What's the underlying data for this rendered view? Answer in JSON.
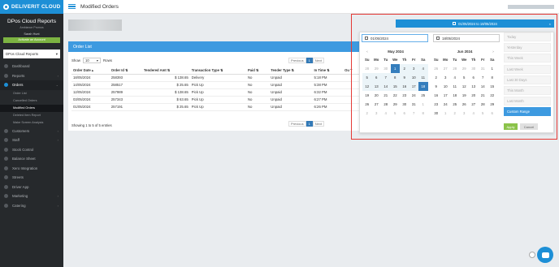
{
  "app": {
    "brand": "DELIVERIT CLOUD",
    "page_title": "Modified Orders"
  },
  "sidebar": {
    "title": "DPos Cloud Reports",
    "subtitle": "Ambiance Promos",
    "user": "Sarah Hunt",
    "activate_label": "Activate an Account",
    "store_select": "DPos Cloud Reports",
    "items": [
      {
        "label": "Dashboard"
      },
      {
        "label": "Reports"
      },
      {
        "label": "Orders"
      },
      {
        "label": "Customers"
      },
      {
        "label": "Staff"
      },
      {
        "label": "Stock Control"
      },
      {
        "label": "Balance Sheet"
      },
      {
        "label": "Xero Integration"
      },
      {
        "label": "Streets"
      },
      {
        "label": "Driver App"
      },
      {
        "label": "Marketing"
      },
      {
        "label": "Catering"
      }
    ],
    "orders_sub": [
      {
        "label": "Order List"
      },
      {
        "label": "Cancelled Orders"
      },
      {
        "label": "Modified Orders"
      },
      {
        "label": "Deleted Item Report"
      },
      {
        "label": "Make Screen Analysis"
      }
    ]
  },
  "order_list": {
    "title": "Order List",
    "show_label": "Show",
    "rows_value": "10",
    "rows_label": "Rows",
    "pager": {
      "prev": "Previous",
      "page": "1",
      "next": "Next"
    },
    "columns": [
      "Order Date",
      "Order Id",
      "Tendered Amt",
      "Transaction Type",
      "Paid",
      "Tender Type",
      "In Time",
      "Ou T"
    ],
    "rows": [
      [
        "18/05/2024",
        "258393",
        "$ 138.65",
        "Delivery",
        "No",
        "Unpaid",
        "5:18 PM"
      ],
      [
        "14/05/2024",
        "258517",
        "$ 25.65",
        "Pick Up",
        "No",
        "Unpaid",
        "5:38 PM"
      ],
      [
        "12/05/2024",
        "257989",
        "$ 138.65",
        "Pick Up",
        "No",
        "Unpaid",
        "6:32 PM"
      ],
      [
        "03/05/2024",
        "257343",
        "$ 63.65",
        "Pick Up",
        "No",
        "Unpaid",
        "6:27 PM"
      ],
      [
        "01/05/2024",
        "257191",
        "$ 25.65",
        "Pick Up",
        "No",
        "Unpaid",
        "6:26 PM"
      ]
    ],
    "showing": "Showing 1 to 5 of 5 entries"
  },
  "date_picker": {
    "range_label": "01/05/2024 to 18/05/2024",
    "start_input": "01/05/2024",
    "end_input": "18/05/2024",
    "dow": [
      "Su",
      "Mo",
      "Tu",
      "We",
      "Th",
      "Fr",
      "Sa"
    ],
    "left_month": "May 2024",
    "right_month": "Jun 2024",
    "left_days": [
      [
        "28",
        "29",
        "30",
        "1",
        "2",
        "3",
        "4"
      ],
      [
        "5",
        "6",
        "7",
        "8",
        "9",
        "10",
        "11"
      ],
      [
        "12",
        "13",
        "14",
        "15",
        "16",
        "17",
        "18"
      ],
      [
        "19",
        "20",
        "21",
        "22",
        "23",
        "24",
        "25"
      ],
      [
        "26",
        "27",
        "28",
        "29",
        "30",
        "31",
        "1"
      ],
      [
        "2",
        "3",
        "4",
        "5",
        "6",
        "7",
        "8"
      ]
    ],
    "right_days": [
      [
        "26",
        "27",
        "28",
        "29",
        "30",
        "31",
        "1"
      ],
      [
        "2",
        "3",
        "4",
        "5",
        "6",
        "7",
        "8"
      ],
      [
        "9",
        "10",
        "11",
        "12",
        "13",
        "14",
        "15"
      ],
      [
        "16",
        "17",
        "18",
        "19",
        "20",
        "21",
        "22"
      ],
      [
        "23",
        "24",
        "25",
        "26",
        "27",
        "28",
        "29"
      ],
      [
        "30",
        "1",
        "2",
        "3",
        "4",
        "5",
        "6"
      ]
    ],
    "ranges": [
      "Today",
      "Yesterday",
      "This Week",
      "Last Week",
      "Last 30 Days",
      "This Month",
      "Last Month",
      "Custom Range"
    ],
    "apply_label": "Apply",
    "cancel_label": "Cancel"
  }
}
